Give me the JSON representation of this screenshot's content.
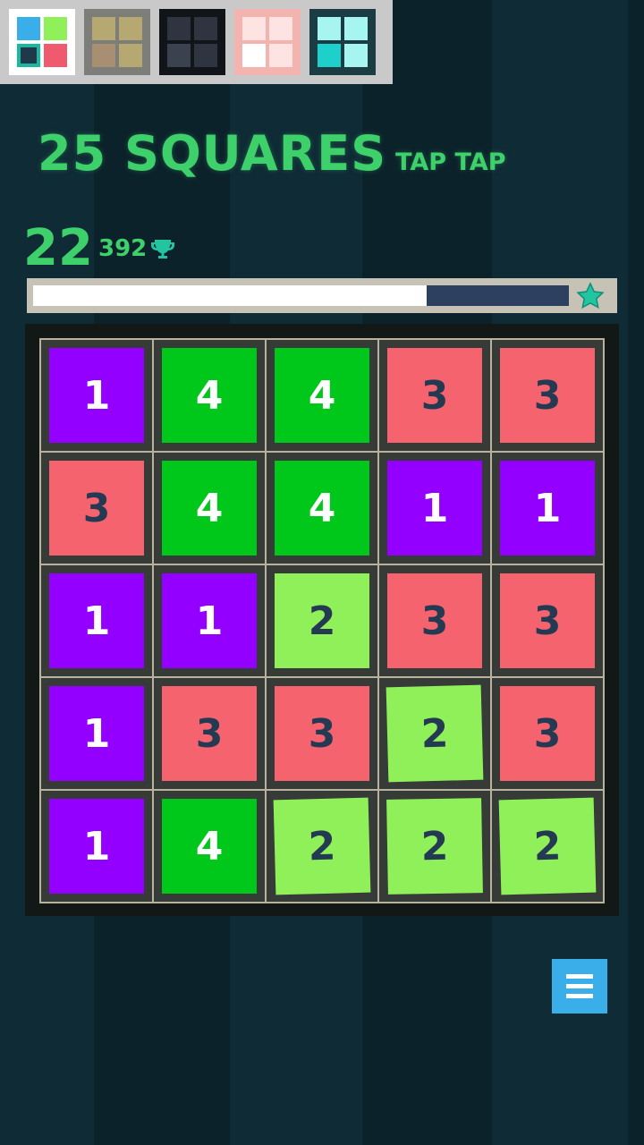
{
  "title": {
    "main": "25 SQUARES",
    "sub": "TAP TAP"
  },
  "score": "22",
  "best_score": "392",
  "icons": {
    "trophy": "trophy-icon",
    "star": "star-icon",
    "menu": "hamburger-menu-icon"
  },
  "progress": {
    "fraction": 0.735
  },
  "themes": [
    {
      "name": "theme-bright",
      "selected": true,
      "frame": "#ffffff",
      "squares": [
        "#3aaee8",
        "#8ff05a",
        "#20384a",
        "#f05a6e"
      ]
    },
    {
      "name": "theme-sand",
      "selected": false,
      "frame": "#7d7d7a",
      "squares": [
        "#b5a870",
        "#b5a870",
        "#a88f72",
        "#b5a870"
      ]
    },
    {
      "name": "theme-dark",
      "selected": false,
      "frame": "#111418",
      "squares": [
        "#2e3540",
        "#2e3540",
        "#3a4250",
        "#2e3540"
      ]
    },
    {
      "name": "theme-pink",
      "selected": false,
      "frame": "#f3b3ae",
      "squares": [
        "#fde3e1",
        "#fde3e1",
        "#ffffff",
        "#fde3e1"
      ]
    },
    {
      "name": "theme-cyan",
      "selected": false,
      "frame": "#1c3c44",
      "squares": [
        "#a6f5f1",
        "#a6f5f1",
        "#1ed0cc",
        "#a6f5f1"
      ]
    }
  ],
  "colors": {
    "1": {
      "bg": "#9300ff",
      "text": "#ffffff"
    },
    "2": {
      "bg": "#8ff05a",
      "text": "#243a52"
    },
    "3": {
      "bg": "#f5636f",
      "text": "#243a52"
    },
    "4": {
      "bg": "#00c81a",
      "text": "#ffffff"
    },
    "accent": "#3ed06a",
    "menu": "#3aaee8"
  },
  "grid": [
    [
      "1",
      "4",
      "4",
      "3",
      "3"
    ],
    [
      "3",
      "4",
      "4",
      "1",
      "1"
    ],
    [
      "1",
      "1",
      "2",
      "3",
      "3"
    ],
    [
      "1",
      "3",
      "3",
      "2",
      "3"
    ],
    [
      "1",
      "4",
      "2",
      "2",
      "2"
    ]
  ]
}
